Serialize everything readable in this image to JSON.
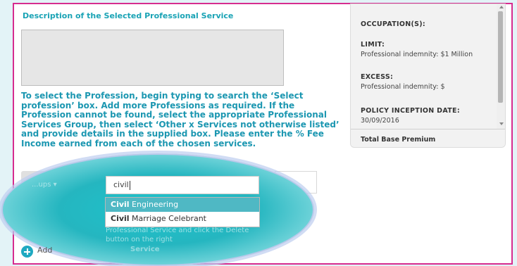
{
  "section": {
    "title": "Description of the Selected Professional Service"
  },
  "instructions": "To select the Profession, begin typing to search the ‘Select profession’ box. Add more Professions as required. If the Profession cannot be found, select the appropriate Professional Services Group, then select ‘Other x Services not otherwise listed’ and provide details in the supplied box. Please enter the % Fee Income earned from each of the chosen services.",
  "sidebar": {
    "occupation_label": "OCCUPATION(S):",
    "limit_label": "LIMIT:",
    "limit_value": "Professional indemnity: $1 Million",
    "excess_label": "EXCESS:",
    "excess_value": "Professional indemnity: $",
    "inception_label": "POLICY INCEPTION DATE:",
    "inception_value": "30/09/2016",
    "footer_label": "Total Base Premium"
  },
  "profession_search": {
    "value": "civil",
    "group_button_partial": "...ups ▾"
  },
  "suggestions": [
    {
      "match": "Civil",
      "rest": " Engineering"
    },
    {
      "match": "Civil",
      "rest": " Marriage Celebrant"
    }
  ],
  "hint": {
    "line1": "Professional Service and click the Delete",
    "line2": "button on the right",
    "line3": "Service"
  },
  "add_link": {
    "label": "Add"
  },
  "colors": {
    "accent": "#1c97b1",
    "frame_border": "#d62c8f",
    "overlay": "#1ec3cc"
  }
}
